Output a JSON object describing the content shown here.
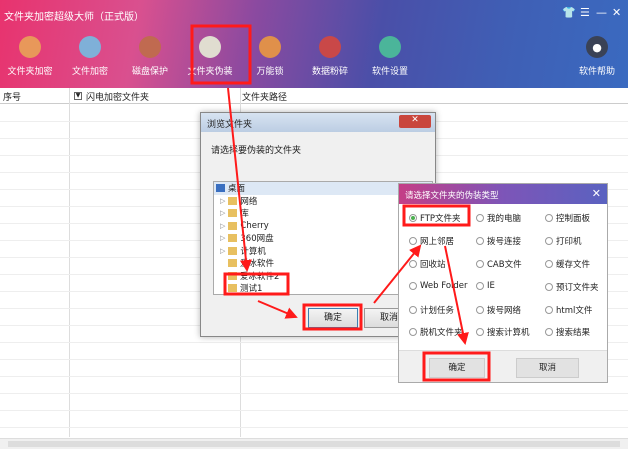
{
  "app": {
    "title": "文件夹加密超级大师（正式版）"
  },
  "toolbar": [
    {
      "label": "文件夹加密",
      "icon": "folder-icon",
      "color": "#e8985a"
    },
    {
      "label": "文件加密",
      "icon": "clipboard-icon",
      "color": "#7fb0d8"
    },
    {
      "label": "磁盘保护",
      "icon": "shield-icon",
      "color": "#c06a50"
    },
    {
      "label": "文件夹伪装",
      "icon": "palette-icon",
      "color": "#e0ddd0"
    },
    {
      "label": "万能锁",
      "icon": "lock-icon",
      "color": "#e0904a"
    },
    {
      "label": "数据粉碎",
      "icon": "scissors-icon",
      "color": "#c94848"
    },
    {
      "label": "软件设置",
      "icon": "gear-icon",
      "color": "#4bb59a"
    }
  ],
  "help": {
    "label": "软件帮助"
  },
  "columns": [
    "序号",
    "闪电加密文件夹",
    "文件夹路径"
  ],
  "browse": {
    "title": "浏览文件夹",
    "prompt": "请选择要伪装的文件夹",
    "ok": "确定",
    "cancel": "取消",
    "tree": [
      "桌面",
      "网络",
      "库",
      "Cherry",
      "360网盘",
      "计算机",
      "爱冰软件",
      "爱冰软件2",
      "测试1"
    ]
  },
  "type_dialog": {
    "title": "请选择文件夹的伪装类型",
    "ok": "确定",
    "cancel": "取消",
    "selected": "FTP文件夹",
    "options": [
      [
        "FTP文件夹",
        "我的电脑",
        "控制面板"
      ],
      [
        "网上邻居",
        "拨号连接",
        "打印机"
      ],
      [
        "回收站",
        "CAB文件",
        "缓存文件"
      ],
      [
        "Web Folder",
        "IE",
        "预订文件夹"
      ],
      [
        "计划任务",
        "拨号网络",
        "html文件"
      ],
      [
        "脱机文件夹",
        "搜索计算机",
        "搜索结果"
      ]
    ]
  },
  "highlight_color": "#ff1a1a"
}
